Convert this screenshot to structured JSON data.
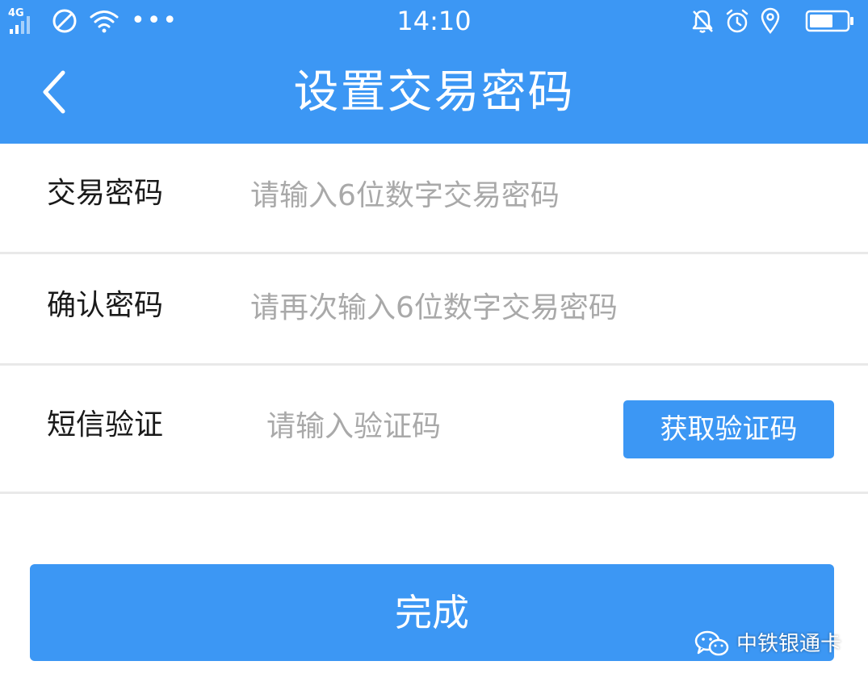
{
  "status_bar": {
    "network": "4G",
    "time": "14:10",
    "more": "•••"
  },
  "nav": {
    "title": "设置交易密码"
  },
  "form": {
    "password": {
      "label": "交易密码",
      "placeholder": "请输入6位数字交易密码"
    },
    "confirm": {
      "label": "确认密码",
      "placeholder": "请再次输入6位数字交易密码"
    },
    "sms": {
      "label": "短信验证",
      "placeholder": "请输入验证码",
      "button_label": "获取验证码"
    }
  },
  "done_button": "完成",
  "watermark": "中铁银通卡",
  "colors": {
    "primary": "#3c97f4",
    "divider": "#e9e9e9",
    "placeholder": "#a9a9a9"
  },
  "icons": {
    "status_left": [
      "signal-icon",
      "do-not-disturb-icon",
      "wifi-icon"
    ],
    "status_right": [
      "bell-off-icon",
      "alarm-icon",
      "location-icon",
      "battery-icon"
    ],
    "nav": "back-arrow-icon",
    "watermark": "wechat-icon"
  }
}
